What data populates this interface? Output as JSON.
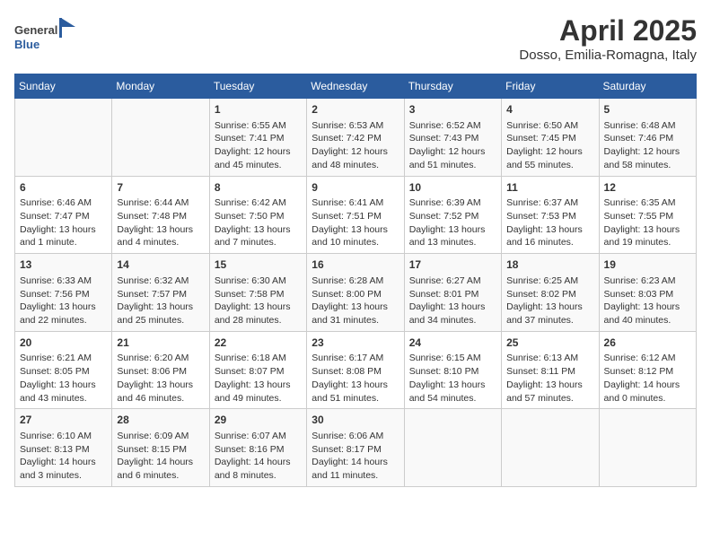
{
  "header": {
    "logo_general": "General",
    "logo_blue": "Blue",
    "title": "April 2025",
    "subtitle": "Dosso, Emilia-Romagna, Italy"
  },
  "weekdays": [
    "Sunday",
    "Monday",
    "Tuesday",
    "Wednesday",
    "Thursday",
    "Friday",
    "Saturday"
  ],
  "weeks": [
    [
      {
        "day": "",
        "info": ""
      },
      {
        "day": "",
        "info": ""
      },
      {
        "day": "1",
        "info": "Sunrise: 6:55 AM\nSunset: 7:41 PM\nDaylight: 12 hours\nand 45 minutes."
      },
      {
        "day": "2",
        "info": "Sunrise: 6:53 AM\nSunset: 7:42 PM\nDaylight: 12 hours\nand 48 minutes."
      },
      {
        "day": "3",
        "info": "Sunrise: 6:52 AM\nSunset: 7:43 PM\nDaylight: 12 hours\nand 51 minutes."
      },
      {
        "day": "4",
        "info": "Sunrise: 6:50 AM\nSunset: 7:45 PM\nDaylight: 12 hours\nand 55 minutes."
      },
      {
        "day": "5",
        "info": "Sunrise: 6:48 AM\nSunset: 7:46 PM\nDaylight: 12 hours\nand 58 minutes."
      }
    ],
    [
      {
        "day": "6",
        "info": "Sunrise: 6:46 AM\nSunset: 7:47 PM\nDaylight: 13 hours\nand 1 minute."
      },
      {
        "day": "7",
        "info": "Sunrise: 6:44 AM\nSunset: 7:48 PM\nDaylight: 13 hours\nand 4 minutes."
      },
      {
        "day": "8",
        "info": "Sunrise: 6:42 AM\nSunset: 7:50 PM\nDaylight: 13 hours\nand 7 minutes."
      },
      {
        "day": "9",
        "info": "Sunrise: 6:41 AM\nSunset: 7:51 PM\nDaylight: 13 hours\nand 10 minutes."
      },
      {
        "day": "10",
        "info": "Sunrise: 6:39 AM\nSunset: 7:52 PM\nDaylight: 13 hours\nand 13 minutes."
      },
      {
        "day": "11",
        "info": "Sunrise: 6:37 AM\nSunset: 7:53 PM\nDaylight: 13 hours\nand 16 minutes."
      },
      {
        "day": "12",
        "info": "Sunrise: 6:35 AM\nSunset: 7:55 PM\nDaylight: 13 hours\nand 19 minutes."
      }
    ],
    [
      {
        "day": "13",
        "info": "Sunrise: 6:33 AM\nSunset: 7:56 PM\nDaylight: 13 hours\nand 22 minutes."
      },
      {
        "day": "14",
        "info": "Sunrise: 6:32 AM\nSunset: 7:57 PM\nDaylight: 13 hours\nand 25 minutes."
      },
      {
        "day": "15",
        "info": "Sunrise: 6:30 AM\nSunset: 7:58 PM\nDaylight: 13 hours\nand 28 minutes."
      },
      {
        "day": "16",
        "info": "Sunrise: 6:28 AM\nSunset: 8:00 PM\nDaylight: 13 hours\nand 31 minutes."
      },
      {
        "day": "17",
        "info": "Sunrise: 6:27 AM\nSunset: 8:01 PM\nDaylight: 13 hours\nand 34 minutes."
      },
      {
        "day": "18",
        "info": "Sunrise: 6:25 AM\nSunset: 8:02 PM\nDaylight: 13 hours\nand 37 minutes."
      },
      {
        "day": "19",
        "info": "Sunrise: 6:23 AM\nSunset: 8:03 PM\nDaylight: 13 hours\nand 40 minutes."
      }
    ],
    [
      {
        "day": "20",
        "info": "Sunrise: 6:21 AM\nSunset: 8:05 PM\nDaylight: 13 hours\nand 43 minutes."
      },
      {
        "day": "21",
        "info": "Sunrise: 6:20 AM\nSunset: 8:06 PM\nDaylight: 13 hours\nand 46 minutes."
      },
      {
        "day": "22",
        "info": "Sunrise: 6:18 AM\nSunset: 8:07 PM\nDaylight: 13 hours\nand 49 minutes."
      },
      {
        "day": "23",
        "info": "Sunrise: 6:17 AM\nSunset: 8:08 PM\nDaylight: 13 hours\nand 51 minutes."
      },
      {
        "day": "24",
        "info": "Sunrise: 6:15 AM\nSunset: 8:10 PM\nDaylight: 13 hours\nand 54 minutes."
      },
      {
        "day": "25",
        "info": "Sunrise: 6:13 AM\nSunset: 8:11 PM\nDaylight: 13 hours\nand 57 minutes."
      },
      {
        "day": "26",
        "info": "Sunrise: 6:12 AM\nSunset: 8:12 PM\nDaylight: 14 hours\nand 0 minutes."
      }
    ],
    [
      {
        "day": "27",
        "info": "Sunrise: 6:10 AM\nSunset: 8:13 PM\nDaylight: 14 hours\nand 3 minutes."
      },
      {
        "day": "28",
        "info": "Sunrise: 6:09 AM\nSunset: 8:15 PM\nDaylight: 14 hours\nand 6 minutes."
      },
      {
        "day": "29",
        "info": "Sunrise: 6:07 AM\nSunset: 8:16 PM\nDaylight: 14 hours\nand 8 minutes."
      },
      {
        "day": "30",
        "info": "Sunrise: 6:06 AM\nSunset: 8:17 PM\nDaylight: 14 hours\nand 11 minutes."
      },
      {
        "day": "",
        "info": ""
      },
      {
        "day": "",
        "info": ""
      },
      {
        "day": "",
        "info": ""
      }
    ]
  ]
}
